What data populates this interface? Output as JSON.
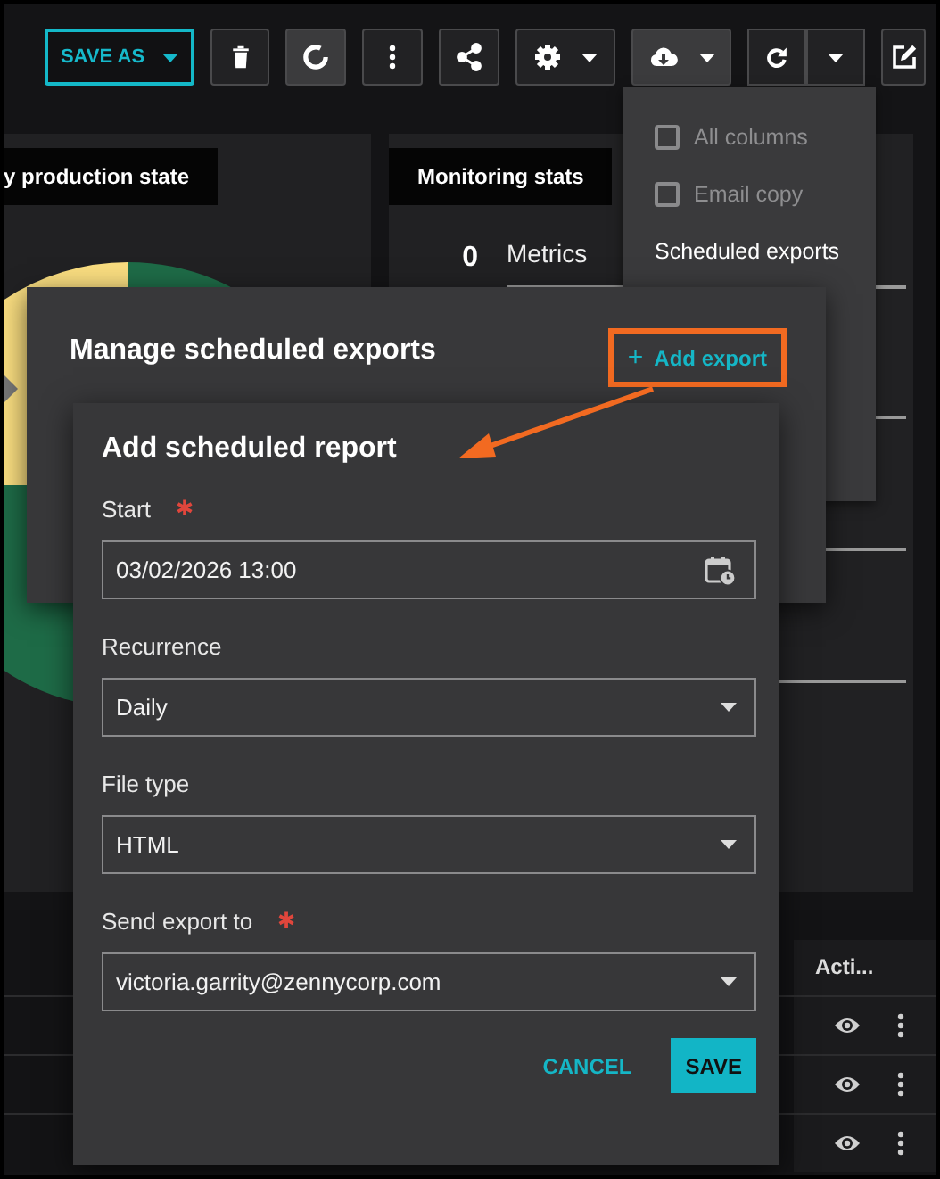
{
  "toolbar": {
    "save_as": {
      "label": "SAVE AS"
    },
    "export_button": {
      "expanded": true
    }
  },
  "panels": [
    {
      "kind": "chart",
      "title": "y production state"
    },
    {
      "kind": "stats",
      "title": "Monitoring stats",
      "stats": [
        {
          "value": "0",
          "label": "Metrics"
        }
      ]
    }
  ],
  "table": {
    "columns": [
      {
        "label": "Acti..."
      }
    ],
    "rows": [
      {
        "kind": "action-row"
      },
      {
        "kind": "action-row"
      },
      {
        "kind": "action-row"
      }
    ]
  },
  "export_menu": {
    "items": [
      {
        "kind": "checkbox",
        "label": "All columns",
        "checked": false,
        "disabled": true
      },
      {
        "kind": "checkbox",
        "label": "Email copy",
        "checked": false,
        "disabled": true
      },
      {
        "kind": "link",
        "label": "Scheduled exports",
        "disabled": false
      }
    ]
  },
  "manage_dialog": {
    "title": "Manage scheduled exports",
    "add_button": {
      "icon": "+",
      "label": "Add export",
      "highlighted": true
    }
  },
  "add_dialog": {
    "title": "Add scheduled report",
    "annotated": true,
    "required_mark": "✱",
    "fields": [
      {
        "kind": "datetime",
        "label": "Start",
        "required": true,
        "value": "03/02/2026 13:00"
      },
      {
        "kind": "select",
        "label": "Recurrence",
        "required": false,
        "value": "Daily"
      },
      {
        "kind": "select",
        "label": "File type",
        "required": false,
        "value": "HTML"
      },
      {
        "kind": "select",
        "label": "Send export to",
        "required": true,
        "value": "victoria.garrity@zennycorp.com"
      }
    ],
    "buttons": [
      {
        "kind": "text",
        "label": "CANCEL"
      },
      {
        "kind": "primary",
        "label": "SAVE"
      }
    ]
  }
}
